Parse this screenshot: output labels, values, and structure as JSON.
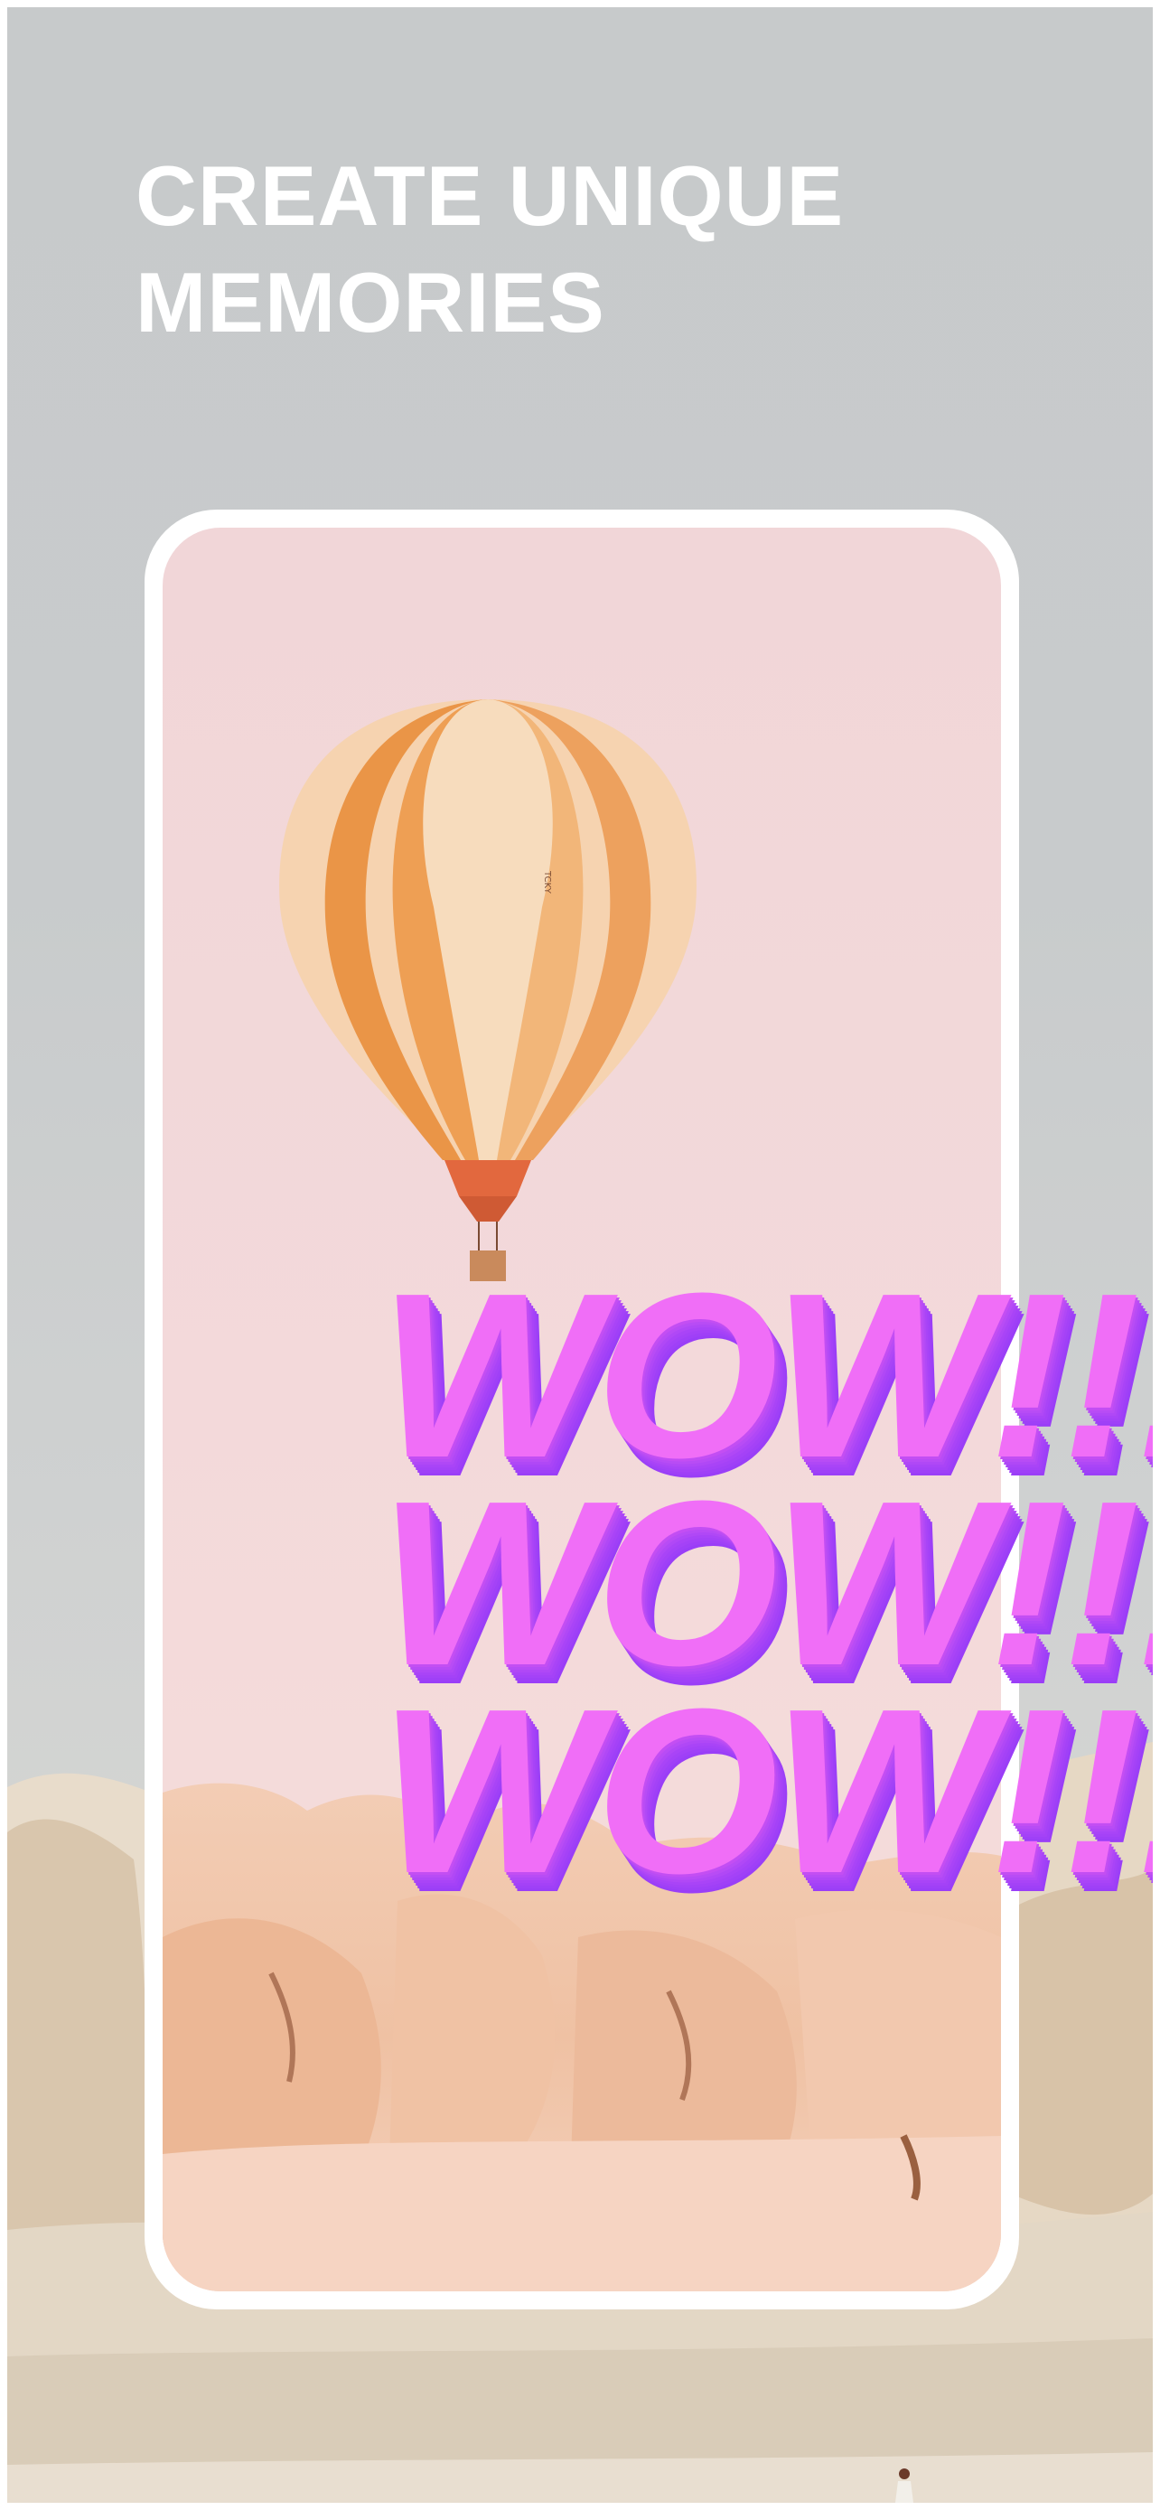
{
  "headline": {
    "line1": "CREATE UNIQUE",
    "line2": "MEMORIES"
  },
  "overlay_text": {
    "lines": [
      "WOW!!!",
      "WOW!!!",
      "WOW!!!"
    ],
    "color": "#f06ef7",
    "shadow_color": "#9a3ef7"
  },
  "balloon": {
    "marking": "TCKY"
  },
  "colors": {
    "background_sky": "#c8cbcc",
    "phone_frame": "#ffffff",
    "phone_sky": "#f2d7d8",
    "balloon_orange": "#ec9f52",
    "balloon_cream": "#f6d2ae",
    "rocks": "#f1c6ab"
  }
}
